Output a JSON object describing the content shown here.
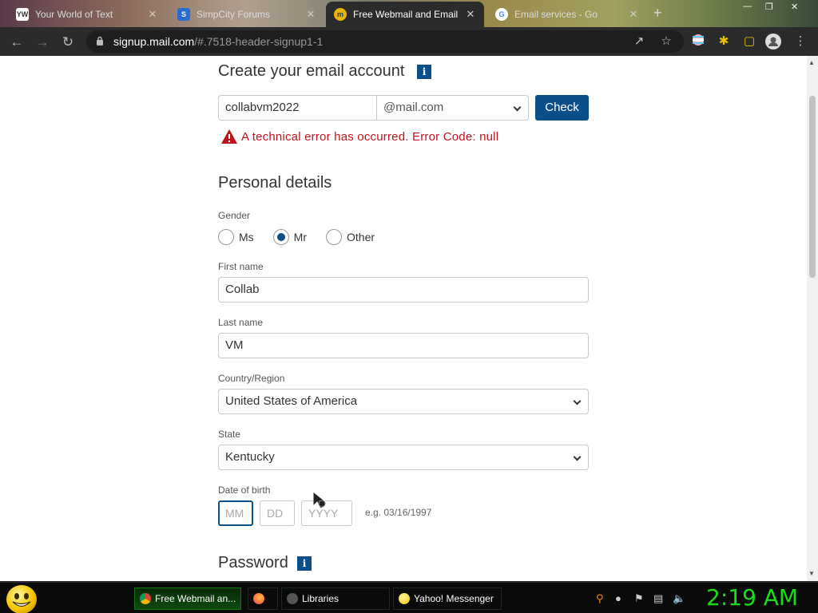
{
  "browser": {
    "tabs": [
      {
        "title": "Your World of Text",
        "favicon": "ywot-icon",
        "active": false
      },
      {
        "title": "SimpCity Forums",
        "favicon": "simp-icon",
        "active": false
      },
      {
        "title": "Free Webmail and Email",
        "favicon": "mail-icon",
        "active": true
      },
      {
        "title": "Email services - Go",
        "favicon": "google-icon",
        "active": false
      }
    ],
    "url_host": "signup.mail.com",
    "url_path": "/#.7518-header-signup1-1"
  },
  "form": {
    "create_heading": "Create your email account",
    "info_glyph": "i",
    "email_username": "collabvm2022",
    "email_domain": "@mail.com",
    "check_label": "Check",
    "error_message": "A technical error has occurred. Error Code: null",
    "personal_heading": "Personal details",
    "gender_label": "Gender",
    "gender_options": [
      "Ms",
      "Mr",
      "Other"
    ],
    "gender_selected": "Mr",
    "first_name_label": "First name",
    "first_name": "Collab",
    "last_name_label": "Last name",
    "last_name": "VM",
    "country_label": "Country/Region",
    "country": "United States of America",
    "state_label": "State",
    "state": "Kentucky",
    "dob_label": "Date of birth",
    "dob_mm": "MM",
    "dob_dd": "DD",
    "dob_yyyy": "YYYY",
    "dob_hint": "e.g. 03/16/1997",
    "password_heading": "Password"
  },
  "taskbar": {
    "tasks": [
      "Free Webmail an...",
      "",
      "Libraries",
      "Yahoo! Messenger"
    ],
    "clock": "2:19 AM"
  },
  "colors": {
    "brand": "#0b4f8a",
    "error": "#c0141d",
    "clock": "#18e018"
  }
}
